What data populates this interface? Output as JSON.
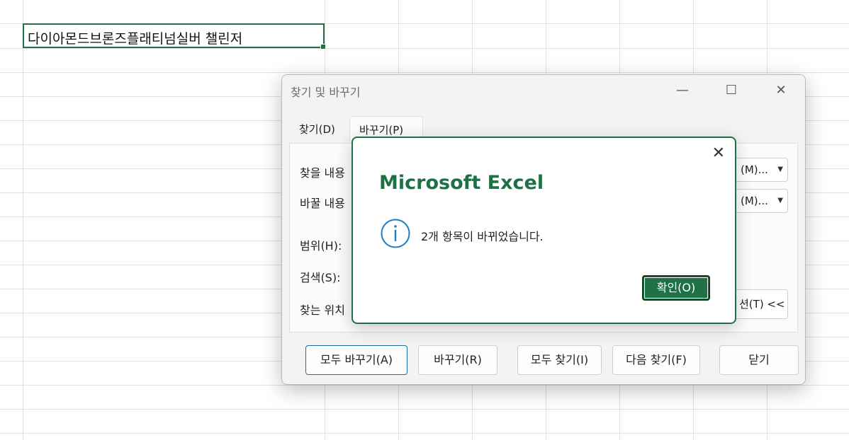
{
  "sheet": {
    "active_cell_text": "다이아몬드브론즈플래티넘실버 챌린저"
  },
  "find_replace": {
    "title": "찾기 및 바꾸기",
    "minimize_glyph": "—",
    "maximize_glyph": "☐",
    "close_glyph": "✕",
    "tabs": [
      {
        "label": "찾기(D)",
        "active": false
      },
      {
        "label": "바꾸기(P)",
        "active": true
      }
    ],
    "find_what_label": "찾을 내용",
    "replace_with_label": "바꿀 내용",
    "format_button_1": "(M)...",
    "format_button_2": "(M)...",
    "within_label": "범위(H):",
    "search_label": "검색(S):",
    "look_in_label": "찾는 위치",
    "options_button": "션(T) <<",
    "buttons": {
      "replace_all": "모두 바꾸기(A)",
      "replace": "바꾸기(R)",
      "find_all": "모두 찾기(I)",
      "find_next": "다음 찾기(F)",
      "close": "닫기"
    }
  },
  "message_box": {
    "title": "Microsoft Excel",
    "message": "2개 항목이 바뀌었습니다.",
    "ok_label": "확인(O)",
    "close_glyph": "✕",
    "icon": "info-icon",
    "accent_color": "#1e7145",
    "icon_color": "#1b7ec2"
  }
}
